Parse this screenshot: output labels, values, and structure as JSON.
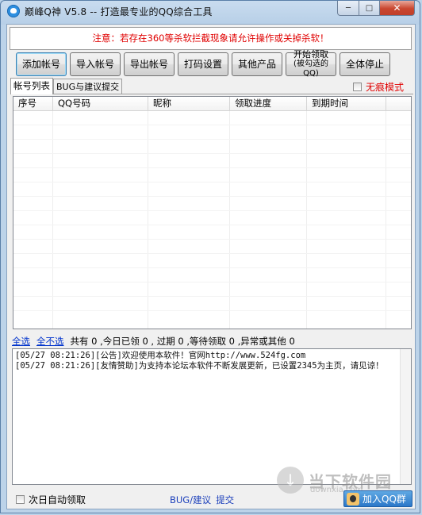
{
  "window": {
    "title": "巅峰Q神 V5.8 -- 打造最专业的QQ综合工具",
    "min_icon": "minimize-icon",
    "max_icon": "maximize-icon",
    "close_icon": "close-icon"
  },
  "notice": "注意：若存在360等杀软拦截现象请允许操作或关掉杀软！",
  "toolbar": {
    "add": "添加帐号",
    "import": "导入帐号",
    "export": "导出帐号",
    "captcha": "打码设置",
    "other": "其他产品",
    "start_line1": "开始领取",
    "start_line2": "(被勾选的QQ)",
    "stop_all": "全体停止"
  },
  "tabs": {
    "accounts": "帐号列表",
    "bug": "BUG与建议提交"
  },
  "stealth_mode": "无痕模式",
  "grid": {
    "columns": [
      "序号",
      "QQ号码",
      "昵称",
      "领取进度",
      "到期时间"
    ],
    "rows": []
  },
  "status": {
    "select_all": "全选",
    "select_none": "全不选",
    "summary": "共有 0 ,今日已领 0 , 过期 0 ,等待领取 0 ,异常或其他 0"
  },
  "log": [
    "[05/27 08:21:26][公告]欢迎使用本软件！官网http://www.524fg.com",
    "[05/27 08:21:26][友情赞助]为支持本论坛本软件不断发展更新，已设置2345为主页，请见谅！"
  ],
  "bottom": {
    "auto_claim": "次日自动领取",
    "bug_label": "BUG/建议",
    "submit": "提交",
    "join_qq": "加入QQ群"
  },
  "watermark": {
    "text": "当下软件园",
    "sub": "downxia.com"
  },
  "colors": {
    "notice_red": "#e00000",
    "link_blue": "#0033cc",
    "join_blue": "#2c78c9"
  }
}
